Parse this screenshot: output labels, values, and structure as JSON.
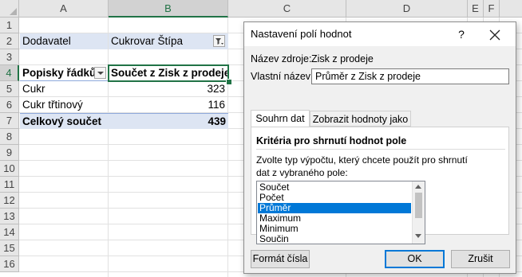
{
  "sheet": {
    "columns": [
      "A",
      "B",
      "C",
      "D",
      "E",
      "F"
    ],
    "rows": [
      "1",
      "2",
      "3",
      "4",
      "5",
      "6",
      "7",
      "8",
      "9",
      "10",
      "11",
      "12",
      "13",
      "14",
      "15",
      "16"
    ],
    "filter_field": "Dodavatel",
    "filter_value": "Cukrovar Štípa",
    "row_labels_header": "Popisky řádků",
    "value_header": "Součet z Zisk z prodeje",
    "items": [
      {
        "label": "Cukr",
        "value": "323"
      },
      {
        "label": "Cukr třtinový",
        "value": "116"
      }
    ],
    "grand_total_label": "Celkový součet",
    "grand_total_value": "439"
  },
  "dialog": {
    "title": "Nastavení polí hodnot",
    "help": "?",
    "source_name_label": "Název zdroje:",
    "source_name_value": "Zisk z prodeje",
    "custom_name_label": "Vlastní název:",
    "custom_name_value": "Průměr z Zisk z prodeje",
    "tabs": [
      "Souhrn dat",
      "Zobrazit hodnoty jako"
    ],
    "section_title": "Kritéria pro shrnutí hodnot pole",
    "instruction_line1": "Zvolte typ výpočtu, který chcete použít pro shrnutí",
    "instruction_line2": "dat z vybraného pole:",
    "functions": [
      "Součet",
      "Počet",
      "Průměr",
      "Maximum",
      "Minimum",
      "Součin"
    ],
    "selected_function": "Průměr",
    "number_format_button": "Formát čísla",
    "ok_button": "OK",
    "cancel_button": "Zrušit"
  },
  "colors": {
    "excel_green": "#217346",
    "pivot_band": "#dde5f3",
    "selection_blue": "#0078d7"
  }
}
